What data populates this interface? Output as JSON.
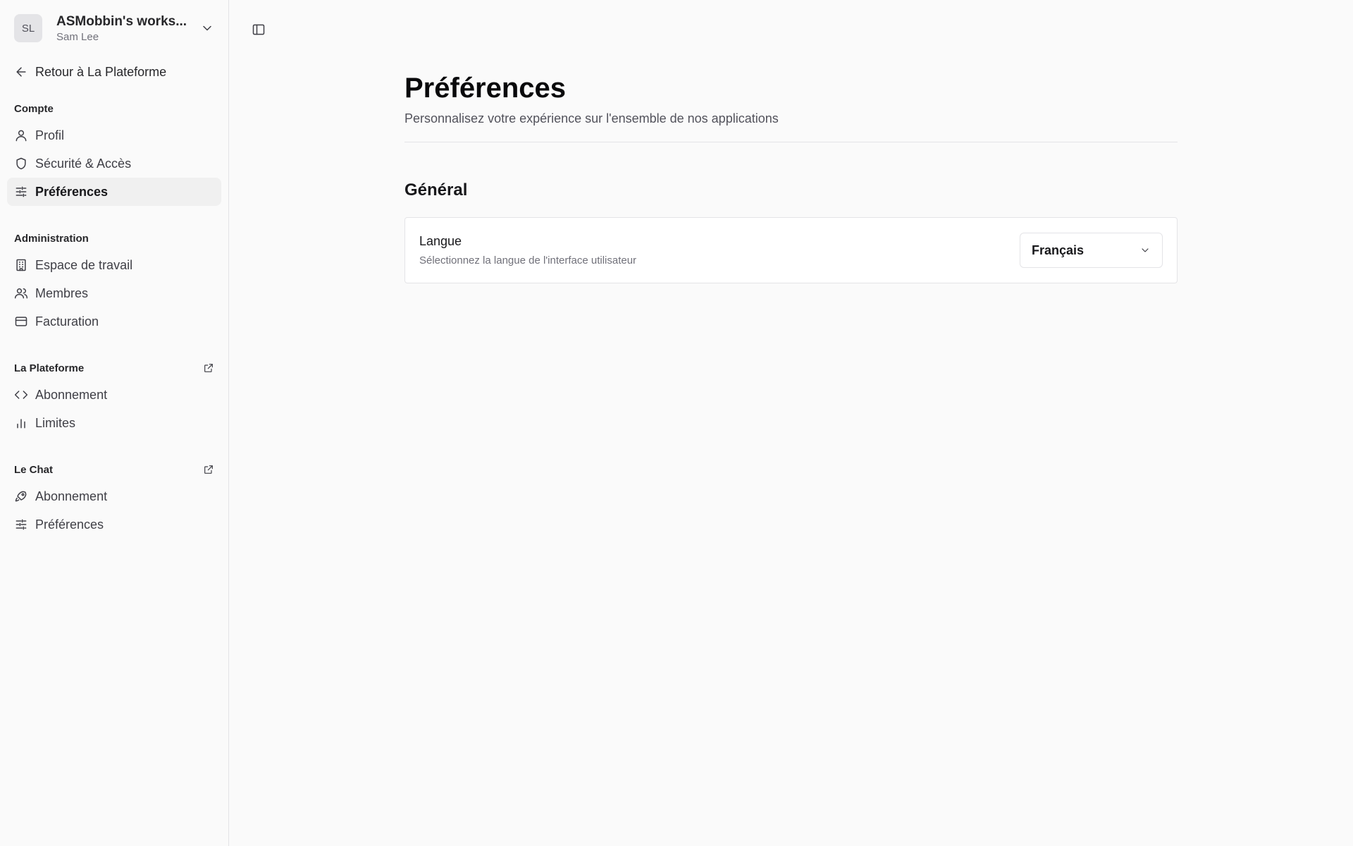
{
  "workspace": {
    "initials": "SL",
    "name": "ASMobbin's works...",
    "user": "Sam Lee"
  },
  "sidebar": {
    "back_label": "Retour à La Plateforme",
    "sections": [
      {
        "title": "Compte",
        "items": [
          {
            "label": "Profil",
            "icon": "user-icon"
          },
          {
            "label": "Sécurité & Accès",
            "icon": "shield-icon"
          },
          {
            "label": "Préférences",
            "icon": "sliders-icon",
            "active": true
          }
        ]
      },
      {
        "title": "Administration",
        "items": [
          {
            "label": "Espace de travail",
            "icon": "building-icon"
          },
          {
            "label": "Membres",
            "icon": "users-icon"
          },
          {
            "label": "Facturation",
            "icon": "credit-card-icon"
          }
        ]
      },
      {
        "title": "La Plateforme",
        "external": true,
        "items": [
          {
            "label": "Abonnement",
            "icon": "code-icon"
          },
          {
            "label": "Limites",
            "icon": "bar-chart-icon"
          }
        ]
      },
      {
        "title": "Le Chat",
        "external": true,
        "items": [
          {
            "label": "Abonnement",
            "icon": "rocket-icon"
          },
          {
            "label": "Préférences",
            "icon": "sliders-icon"
          }
        ]
      }
    ]
  },
  "main": {
    "title": "Préférences",
    "subtitle": "Personnalisez votre expérience sur l'ensemble de nos applications",
    "section_title": "Général",
    "settings": [
      {
        "label": "Langue",
        "description": "Sélectionnez la langue de l'interface utilisateur",
        "value": "Français"
      }
    ]
  }
}
